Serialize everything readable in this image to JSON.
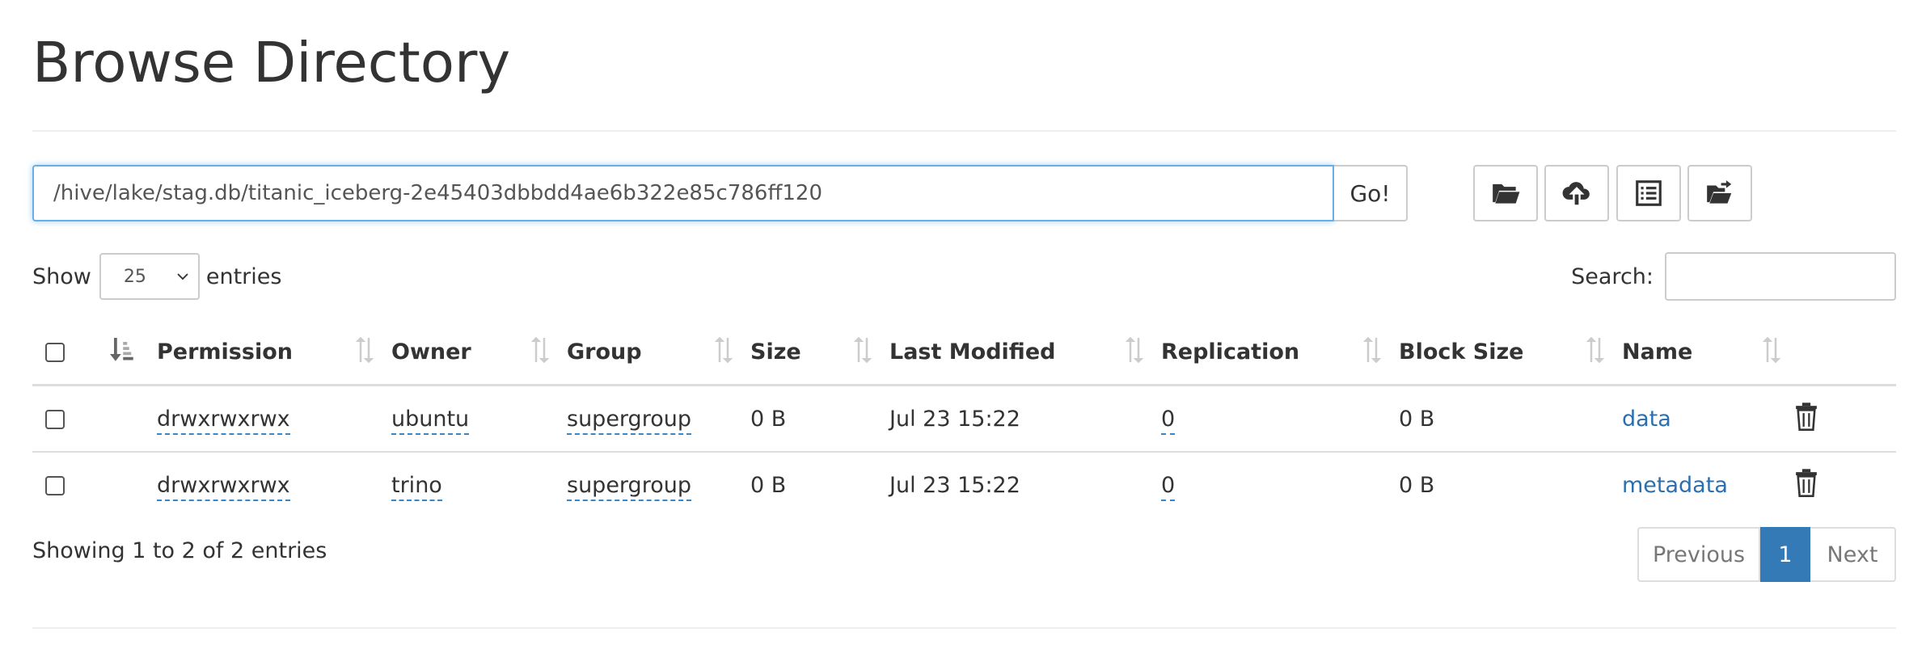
{
  "page": {
    "title": "Browse Directory"
  },
  "path_bar": {
    "value": "/hive/lake/stag.db/titanic_iceberg-2e45403dbbdd4ae6b322e85c786ff120",
    "go_label": "Go!"
  },
  "toolbar": {
    "icons": [
      "open-folder-icon",
      "cloud-upload-icon",
      "list-icon",
      "folder-move-icon"
    ]
  },
  "length_menu": {
    "show_label": "Show",
    "value": "25",
    "entries_label": "entries"
  },
  "search": {
    "label": "Search:",
    "value": ""
  },
  "table": {
    "headers": [
      "Permission",
      "Owner",
      "Group",
      "Size",
      "Last Modified",
      "Replication",
      "Block Size",
      "Name"
    ],
    "rows": [
      {
        "permission": "drwxrwxrwx",
        "owner": "ubuntu",
        "group": "supergroup",
        "size": "0 B",
        "modified": "Jul 23 15:22",
        "replication": "0",
        "block_size": "0 B",
        "name": "data"
      },
      {
        "permission": "drwxrwxrwx",
        "owner": "trino",
        "group": "supergroup",
        "size": "0 B",
        "modified": "Jul 23 15:22",
        "replication": "0",
        "block_size": "0 B",
        "name": "metadata"
      }
    ]
  },
  "footer": {
    "info": "Showing 1 to 2 of 2 entries",
    "previous": "Previous",
    "current_page": "1",
    "next": "Next"
  },
  "colors": {
    "accent": "#337ab7",
    "link": "#2a6fb0",
    "focus": "#66afe9"
  }
}
